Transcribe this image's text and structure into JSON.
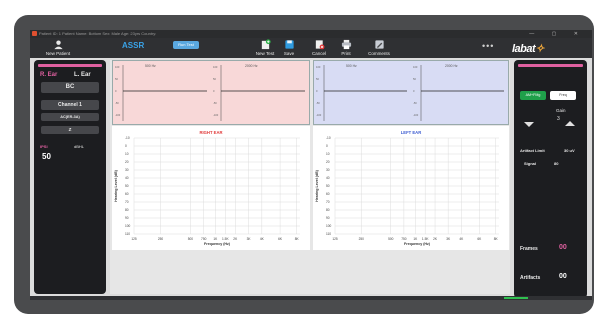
{
  "titlebar": {
    "text": "Patient ID: 1    Patient Name: Bottom    Sex: Male    Age: 23yrs    Country:",
    "controls": "— ▢ ✕"
  },
  "toolbar": {
    "new_patient": "New Patient",
    "assr": "ASSR",
    "run": "Run Test",
    "new_test": "New Test",
    "save": "Save",
    "cancel": "Cancel",
    "print": "Print",
    "comments": "Comments",
    "more": "•••",
    "logo_main": "labat",
    "logo_accent": "✧"
  },
  "left": {
    "r_ear": "R. Ear",
    "l_ear": "L. Ear",
    "bc": "BC",
    "channel": "Channel 1",
    "mode": "AC(ER-3A)",
    "z": "Z",
    "ipsi": "IPSI",
    "unit": "dBHL",
    "level": "50"
  },
  "right": {
    "btn_active": "AM+FMg",
    "btn_freq": "Freq",
    "gain_label": "Gain",
    "gain_value": "3",
    "artifact_limit_label": "Artifact Limit",
    "artifact_limit_value": "30 uV",
    "signal_label": "Signal",
    "signal_value": "80",
    "frames_label": "Frames",
    "frames_value": "00",
    "artifacts_label": "Artifacts",
    "artifacts_value": "00"
  },
  "wave": {
    "right_f1": "500 Hz",
    "right_f2": "2000 Hz",
    "left_f1": "500 Hz",
    "left_f2": "2000 Hz",
    "ticks": [
      "100",
      "50",
      "0",
      "-50",
      "-100"
    ]
  },
  "chart_data": [
    {
      "type": "scatter",
      "title": "RIGHT EAR",
      "xlabel": "Frequency (Hz)",
      "ylabel": "Hearing Level (dB)",
      "x_ticks": [
        "125",
        "250",
        "500",
        "750",
        "1K",
        "1.5K",
        "2K",
        "3K",
        "4K",
        "6K",
        "8K"
      ],
      "y_ticks": [
        "-10",
        "0",
        "10",
        "20",
        "30",
        "40",
        "50",
        "60",
        "70",
        "80",
        "90",
        "100",
        "110"
      ],
      "ylim": [
        -10,
        110
      ],
      "grid": true,
      "series": []
    },
    {
      "type": "scatter",
      "title": "LEFT EAR",
      "xlabel": "Frequency (Hz)",
      "ylabel": "Hearing Level (dB)",
      "x_ticks": [
        "125",
        "250",
        "500",
        "750",
        "1K",
        "1.5K",
        "2K",
        "3K",
        "4K",
        "6K",
        "8K"
      ],
      "y_ticks": [
        "-10",
        "0",
        "10",
        "20",
        "30",
        "40",
        "50",
        "60",
        "70",
        "80",
        "90",
        "100",
        "110"
      ],
      "ylim": [
        -10,
        110
      ],
      "grid": true,
      "series": []
    }
  ],
  "colors": {
    "right_ear": "#e03a3a",
    "left_ear": "#3a5ad0",
    "accent_blue": "#3aa3e8",
    "active_green": "#1fa04a",
    "pink": "#e060a0"
  },
  "icons": {
    "new_patient": "user-icon",
    "new_test": "new-test-icon",
    "save": "save-icon",
    "cancel": "cancel-icon",
    "print": "printer-icon",
    "comments": "comments-icon"
  }
}
